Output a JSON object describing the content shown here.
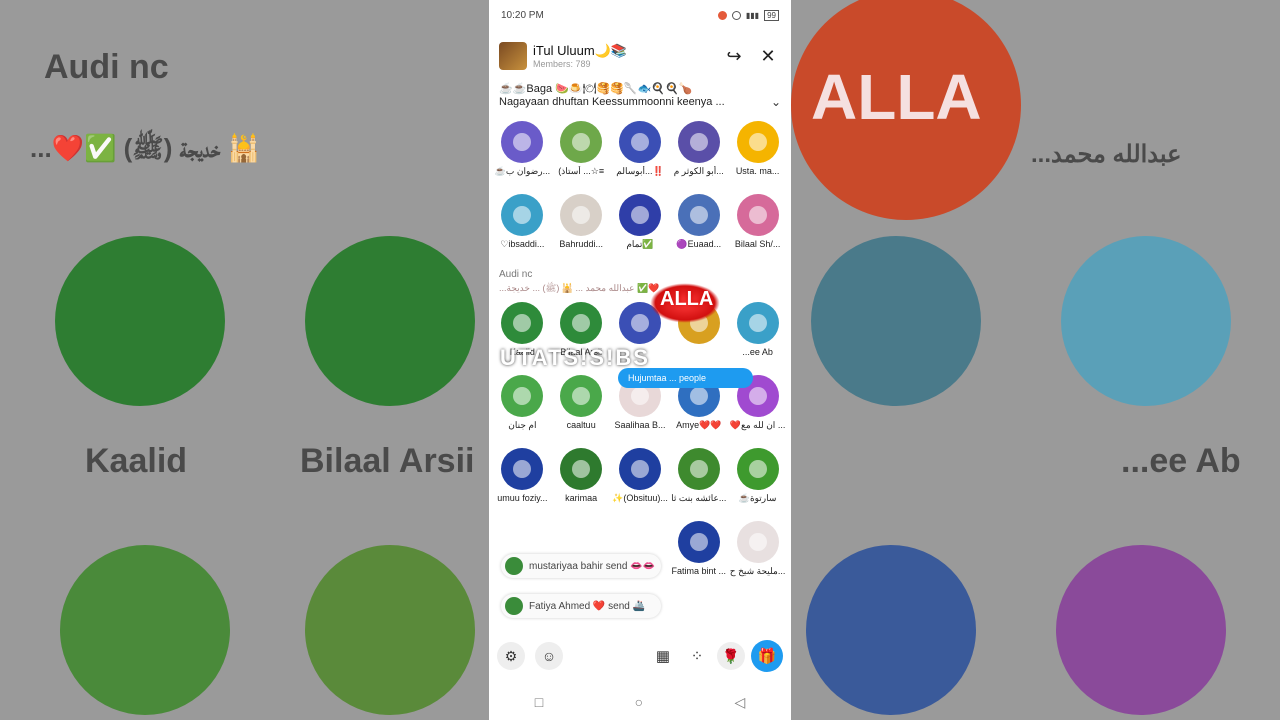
{
  "status": {
    "time": "10:20 PM",
    "battery": "99"
  },
  "header": {
    "title": "iTul Uluum🌙📚",
    "members": "Members: 789"
  },
  "announcement": {
    "line1": "☕☕Baga 🍉🍮🍽🥞🥞🥄🐟🍳🍳🍗",
    "line2": "Nagayaan dhuftan Keessummoonni keenya ..."
  },
  "hosts": [
    {
      "name": "☕رضوان ب...",
      "color": "#6a5bc9"
    },
    {
      "name": "(أستاذ ...☆≡",
      "color": "#6ea84a"
    },
    {
      "name": "أبوسالم...‼️",
      "color": "#3b4fb5"
    },
    {
      "name": "أبو الكوثر م...",
      "color": "#5a4fa8"
    },
    {
      "name": "Usta. ma...",
      "color": "#f5b400"
    },
    {
      "name": "♡ibsaddi...",
      "color": "#3aa0c8"
    },
    {
      "name": "Bahruddi...",
      "color": "#d8d0c8"
    },
    {
      "name": "تمام✅",
      "color": "#2f3ea8"
    },
    {
      "name": "🟣Euaad...",
      "color": "#4a70b8"
    },
    {
      "name": "Bilaal Sh/...",
      "color": "#d66a9a"
    }
  ],
  "audience": {
    "label": "Audi nc",
    "line": "...عبدالله محمد  ...  🕌 (ﷺ) ...  خديجة ✅❤️"
  },
  "audience_members": [
    {
      "name": "Kaalid",
      "color": "#2e8b3a"
    },
    {
      "name": "Bilaal Arsii",
      "color": "#2e8b3a"
    },
    {
      "name": "",
      "color": "#3b4fb5"
    },
    {
      "name": "",
      "color": "#d8a020"
    },
    {
      "name": "...ee Ab",
      "color": "#3aa0c8"
    },
    {
      "name": "ام جنان",
      "color": "#4aa84a"
    },
    {
      "name": "caaltuu",
      "color": "#4aa84a"
    },
    {
      "name": "Saalihaa B...",
      "color": "#e8d8d8"
    },
    {
      "name": "Amye❤️❤️",
      "color": "#2f6fc0"
    },
    {
      "name": "❤️ان لله مع ...",
      "color": "#a04ad0"
    },
    {
      "name": "umuu foziy...",
      "color": "#1f3fa0"
    },
    {
      "name": "karimaa",
      "color": "#2e7a2e"
    },
    {
      "name": "✨(Obsituu)...",
      "color": "#1f3fa0"
    },
    {
      "name": "عائشه بنت ثا...",
      "color": "#3e8a2e"
    },
    {
      "name": "☕سارتوة",
      "color": "#3e9a2e"
    },
    {
      "name": "",
      "color": "#ffffff"
    },
    {
      "name": "",
      "color": "#ffffff"
    },
    {
      "name": "",
      "color": "#ffffff"
    },
    {
      "name": "Fatima bint ...",
      "color": "#1f3fa0"
    },
    {
      "name": "مليحة شيخ ح...",
      "color": "#e8e0e0"
    }
  ],
  "gift_notices": [
    {
      "text": "mustariyaa bahir send 👄👄"
    },
    {
      "text": "Fatiya Ahmed ❤️ send 🚢"
    }
  ],
  "overlay": {
    "title": "ALLA",
    "wave_text": "UTATS!S!BS",
    "chip_text": "Hujumtaa ... people"
  },
  "toolbar": {
    "icon_manage": "⚙",
    "icon_emoji": "☺",
    "icon_calendar": "▦",
    "icon_apps": "⁘",
    "icon_rose": "🌹",
    "icon_gift": "🎁"
  },
  "nav": {
    "back": "◁",
    "home": "○",
    "recent": "□"
  },
  "background": {
    "left_heading": "Audi nc",
    "left_line": "...❤️✅ خديجة  (ﷺ) 🕌",
    "right_line": "...عبدالله محمد",
    "left_names": [
      "Kaalid",
      "Bilaal Arsii"
    ],
    "right_names": [
      "...ee Ab"
    ],
    "right_title": "ALLA"
  },
  "colors": {
    "accent": "#1e9bf0",
    "overlay_red": "#d21010"
  }
}
